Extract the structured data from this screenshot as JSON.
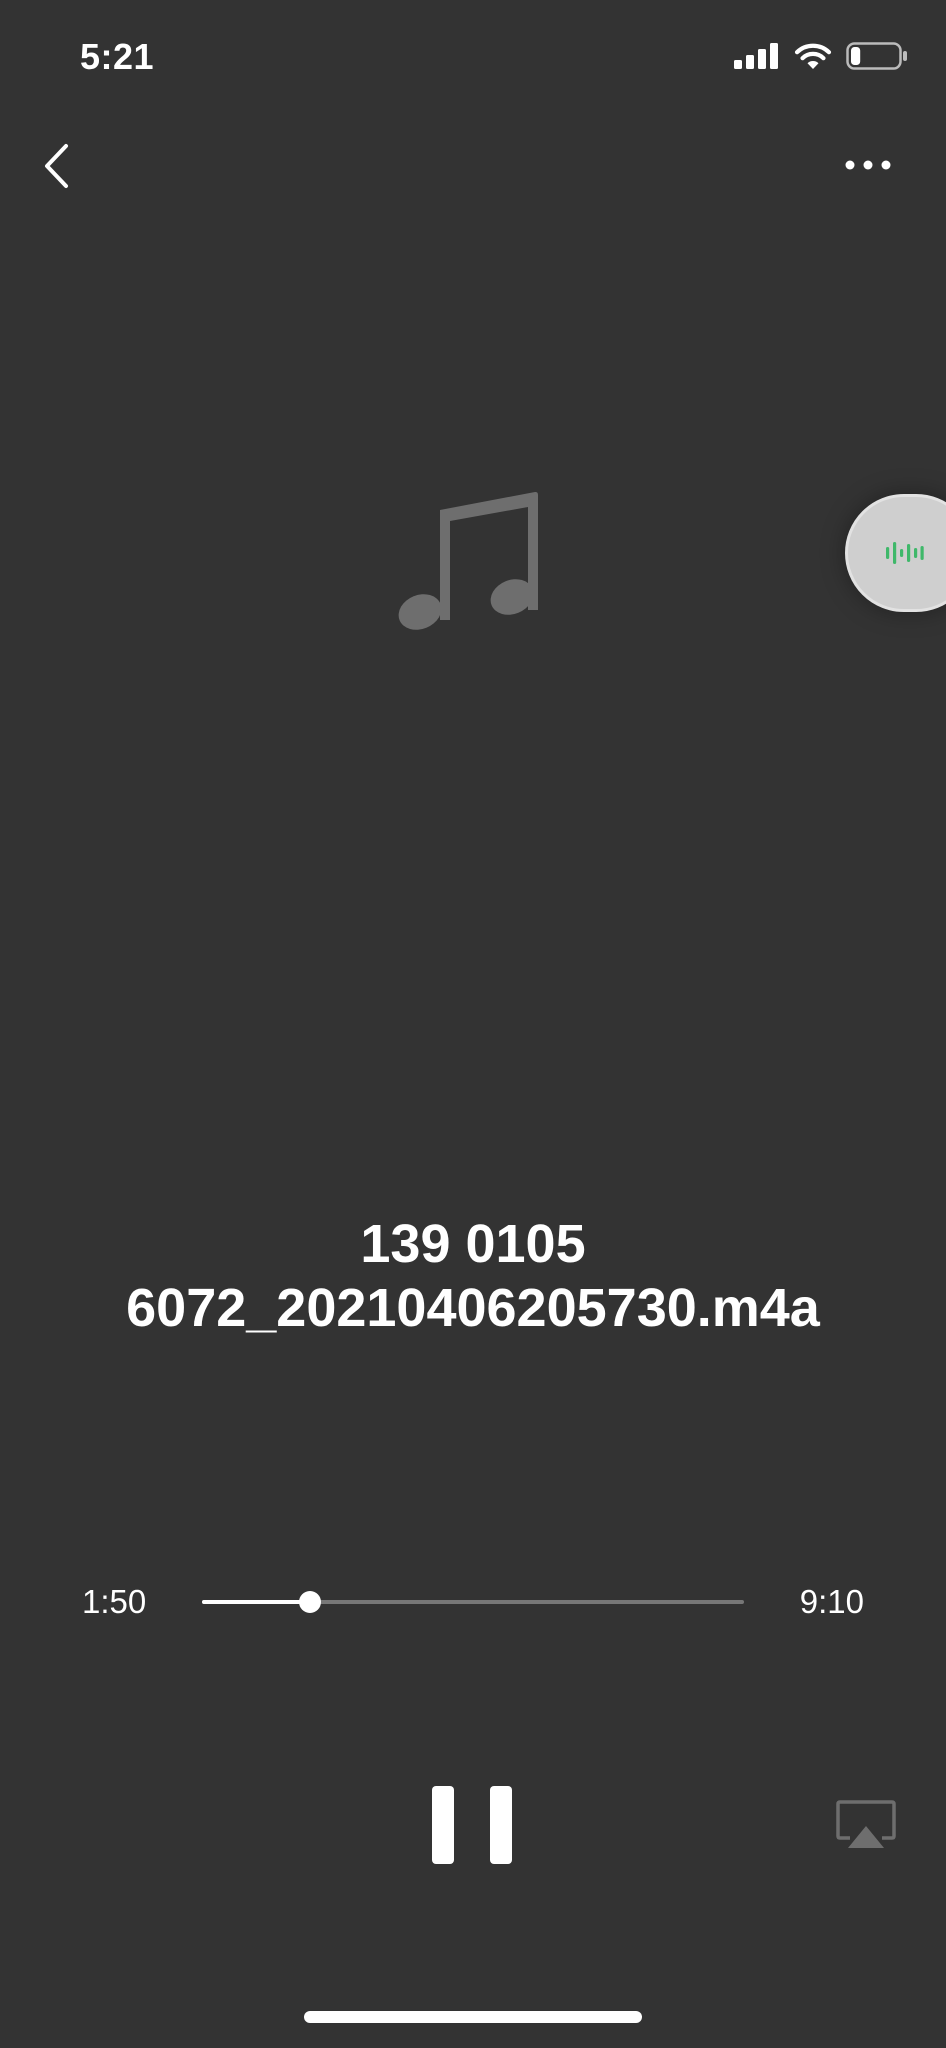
{
  "status_bar": {
    "time": "5:21",
    "signal_icon": "cellular-signal-icon",
    "wifi_icon": "wifi-icon",
    "battery_icon": "battery-icon",
    "battery_level": 0.2
  },
  "nav": {
    "back_icon": "chevron-left-icon",
    "more_icon": "ellipsis-icon"
  },
  "artwork": {
    "icon": "music-note-icon",
    "color": "#6e6e6e"
  },
  "floating_tab": {
    "icon": "audio-waveform-icon",
    "color": "#3fb86a"
  },
  "track": {
    "title_line1": "139 0105",
    "title_line2": "6072_20210406205730.m4a"
  },
  "playback": {
    "elapsed": "1:50",
    "total": "9:10",
    "progress": 0.2
  },
  "controls": {
    "pause_icon": "pause-icon",
    "airplay_icon": "airplay-icon"
  },
  "colors": {
    "background": "#333333",
    "foreground": "#ffffff",
    "track_inactive": "#777777"
  }
}
